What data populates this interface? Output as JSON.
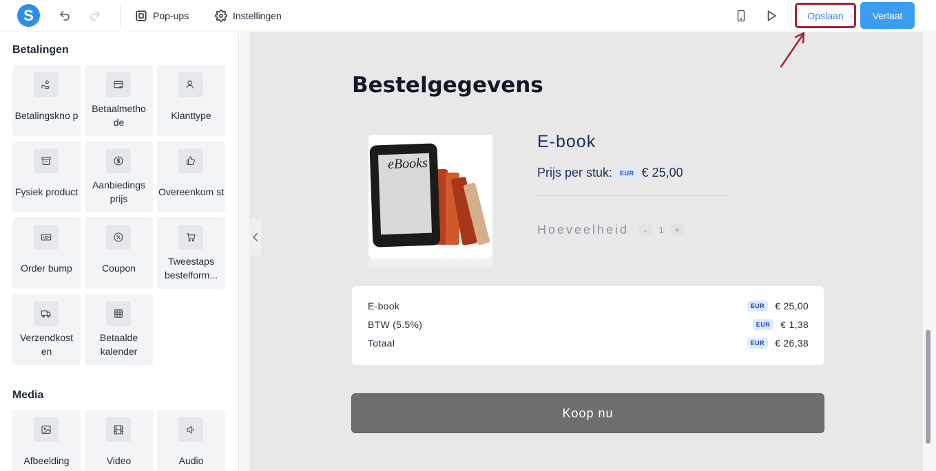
{
  "topbar": {
    "logo_letter": "S",
    "popups_label": "Pop-ups",
    "settings_label": "Instellingen",
    "save_label": "Opslaan",
    "leave_label": "Verlaat"
  },
  "sidebar": {
    "payments_title": "Betalingen",
    "payments_items": [
      {
        "label": "Betalingskno p",
        "icon": "hand-coin-icon"
      },
      {
        "label": "Betaalmetho de",
        "icon": "credit-card-icon"
      },
      {
        "label": "Klanttype",
        "icon": "user-icon"
      },
      {
        "label": "Fysiek product",
        "icon": "archive-box-icon"
      },
      {
        "label": "Aanbiedings prijs",
        "icon": "dollar-circle-icon"
      },
      {
        "label": "Overeenkom st",
        "icon": "thumbs-up-icon"
      },
      {
        "label": "Order bump",
        "icon": "banknote-icon"
      },
      {
        "label": "Coupon",
        "icon": "coupon-icon"
      },
      {
        "label": "Tweestaps bestelform...",
        "icon": "cart-icon"
      },
      {
        "label": "Verzendkost en",
        "icon": "truck-icon"
      },
      {
        "label": "Betaalde kalender",
        "icon": "calendar-grid-icon"
      }
    ],
    "media_title": "Media",
    "media_items": [
      {
        "label": "Afbeelding",
        "icon": "image-icon"
      },
      {
        "label": "Video",
        "icon": "film-icon"
      },
      {
        "label": "Audio",
        "icon": "speaker-icon"
      }
    ]
  },
  "page": {
    "heading": "Bestelgegevens",
    "product": {
      "image_text": "eBooks",
      "title": "E-book",
      "price_label": "Prijs per stuk:",
      "currency_badge": "EUR",
      "price": "€ 25,00",
      "quantity_label": "Hoeveelheid",
      "quantity_minus": "-",
      "quantity_value": "1",
      "quantity_plus": "+"
    },
    "summary": [
      {
        "label": "E-book",
        "badge": "EUR",
        "amount": "€ 25,00"
      },
      {
        "label": "BTW (5.5%)",
        "badge": "EUR",
        "amount": "€ 1,38"
      },
      {
        "label": "Totaal",
        "badge": "EUR",
        "amount": "€ 26,38"
      }
    ],
    "buy_label": "Koop nu"
  },
  "colors": {
    "brand": "#2f8fe8",
    "save_highlight": "#a4232f",
    "leave_button": "#3b9cf0",
    "buy_button": "#6e6e6e",
    "product_text": "#1e2f5a"
  }
}
